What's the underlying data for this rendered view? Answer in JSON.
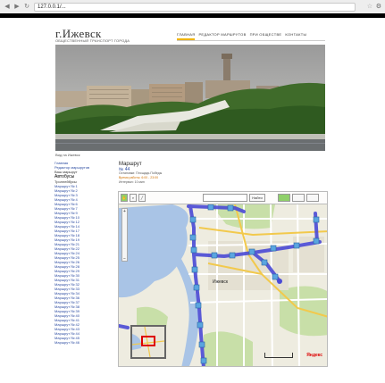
{
  "browser": {
    "url": "127.0.0.1/...",
    "back_icon": "back-arrow-icon",
    "forward_icon": "forward-arrow-icon",
    "reload_icon": "reload-icon"
  },
  "site": {
    "title": "г.Ижевск",
    "subtitle": "ОБЩЕСТВЕННЫЙ ТРАНСПОРТ ГОРОДА"
  },
  "topnav": [
    {
      "label": "ГЛАВНАЯ",
      "active": true
    },
    {
      "label": "РЕДАКТОР МАРШРУТОВ",
      "active": false
    },
    {
      "label": "ПРИ ОБЩЕСТВЕ",
      "active": false
    },
    {
      "label": "КОНТАКТЫ",
      "active": false
    }
  ],
  "hero": {
    "caption": "Вид на Ижевск"
  },
  "leftnav": [
    {
      "label": "Главная",
      "kind": "link"
    },
    {
      "label": "Редактор маршрутов",
      "kind": "link"
    },
    {
      "label": "Ваш маршрут",
      "kind": "text"
    },
    {
      "label": "Автобусы",
      "kind": "head"
    },
    {
      "label": "Троллейбусы",
      "kind": "text"
    },
    {
      "label": "Маршрут № 1",
      "kind": "link"
    },
    {
      "label": "Маршрут № 2",
      "kind": "link"
    },
    {
      "label": "Маршрут № 3",
      "kind": "link"
    },
    {
      "label": "Маршрут № 4",
      "kind": "link"
    },
    {
      "label": "Маршрут № 6",
      "kind": "link"
    },
    {
      "label": "Маршрут № 7",
      "kind": "link"
    },
    {
      "label": "Маршрут № 9",
      "kind": "link"
    },
    {
      "label": "Маршрут № 10",
      "kind": "link"
    },
    {
      "label": "Маршрут № 12",
      "kind": "link"
    },
    {
      "label": "Маршрут № 14",
      "kind": "link"
    },
    {
      "label": "Маршрут № 17",
      "kind": "link"
    },
    {
      "label": "Маршрут № 18",
      "kind": "link"
    },
    {
      "label": "Маршрут № 19",
      "kind": "link"
    },
    {
      "label": "Маршрут № 21",
      "kind": "link"
    },
    {
      "label": "Маршрут № 22",
      "kind": "link"
    },
    {
      "label": "Маршрут № 24",
      "kind": "link"
    },
    {
      "label": "Маршрут № 25",
      "kind": "link"
    },
    {
      "label": "Маршрут № 26",
      "kind": "link"
    },
    {
      "label": "Маршрут № 28",
      "kind": "link"
    },
    {
      "label": "Маршрут № 29",
      "kind": "link"
    },
    {
      "label": "Маршрут № 30",
      "kind": "link"
    },
    {
      "label": "Маршрут № 31",
      "kind": "link"
    },
    {
      "label": "Маршрут № 32",
      "kind": "link"
    },
    {
      "label": "Маршрут № 33",
      "kind": "link"
    },
    {
      "label": "Маршрут № 34",
      "kind": "link"
    },
    {
      "label": "Маршрут № 36",
      "kind": "link"
    },
    {
      "label": "Маршрут № 37",
      "kind": "link"
    },
    {
      "label": "Маршрут № 38",
      "kind": "link"
    },
    {
      "label": "Маршрут № 39",
      "kind": "link"
    },
    {
      "label": "Маршрут № 40",
      "kind": "link"
    },
    {
      "label": "Маршрут № 41",
      "kind": "link"
    },
    {
      "label": "Маршрут № 42",
      "kind": "link"
    },
    {
      "label": "Маршрут № 43",
      "kind": "link"
    },
    {
      "label": "Маршрут № 44",
      "kind": "link"
    },
    {
      "label": "Маршрут № 45",
      "kind": "link"
    },
    {
      "label": "Маршрут № 46",
      "kind": "link"
    }
  ],
  "content": {
    "title": "Маршрут",
    "number_link": "№ 44",
    "lines": [
      "Остановки: Площадь Победы",
      "Время работы: 6:00 - 23:00",
      "Интервал: 10 мин"
    ]
  },
  "map": {
    "city_label": "Ижевск",
    "search_button": "Найти",
    "logo": "Яндекс",
    "colors": {
      "route": "#4a4ad6",
      "water": "#a9c4e6",
      "land": "#eeece0",
      "green": "#c8dfa8",
      "road": "#f2c94c"
    },
    "icons": [
      "hand-tool-icon",
      "magnifier-icon",
      "ruler-icon",
      "zoom-plus-icon",
      "zoom-minus-icon"
    ]
  }
}
